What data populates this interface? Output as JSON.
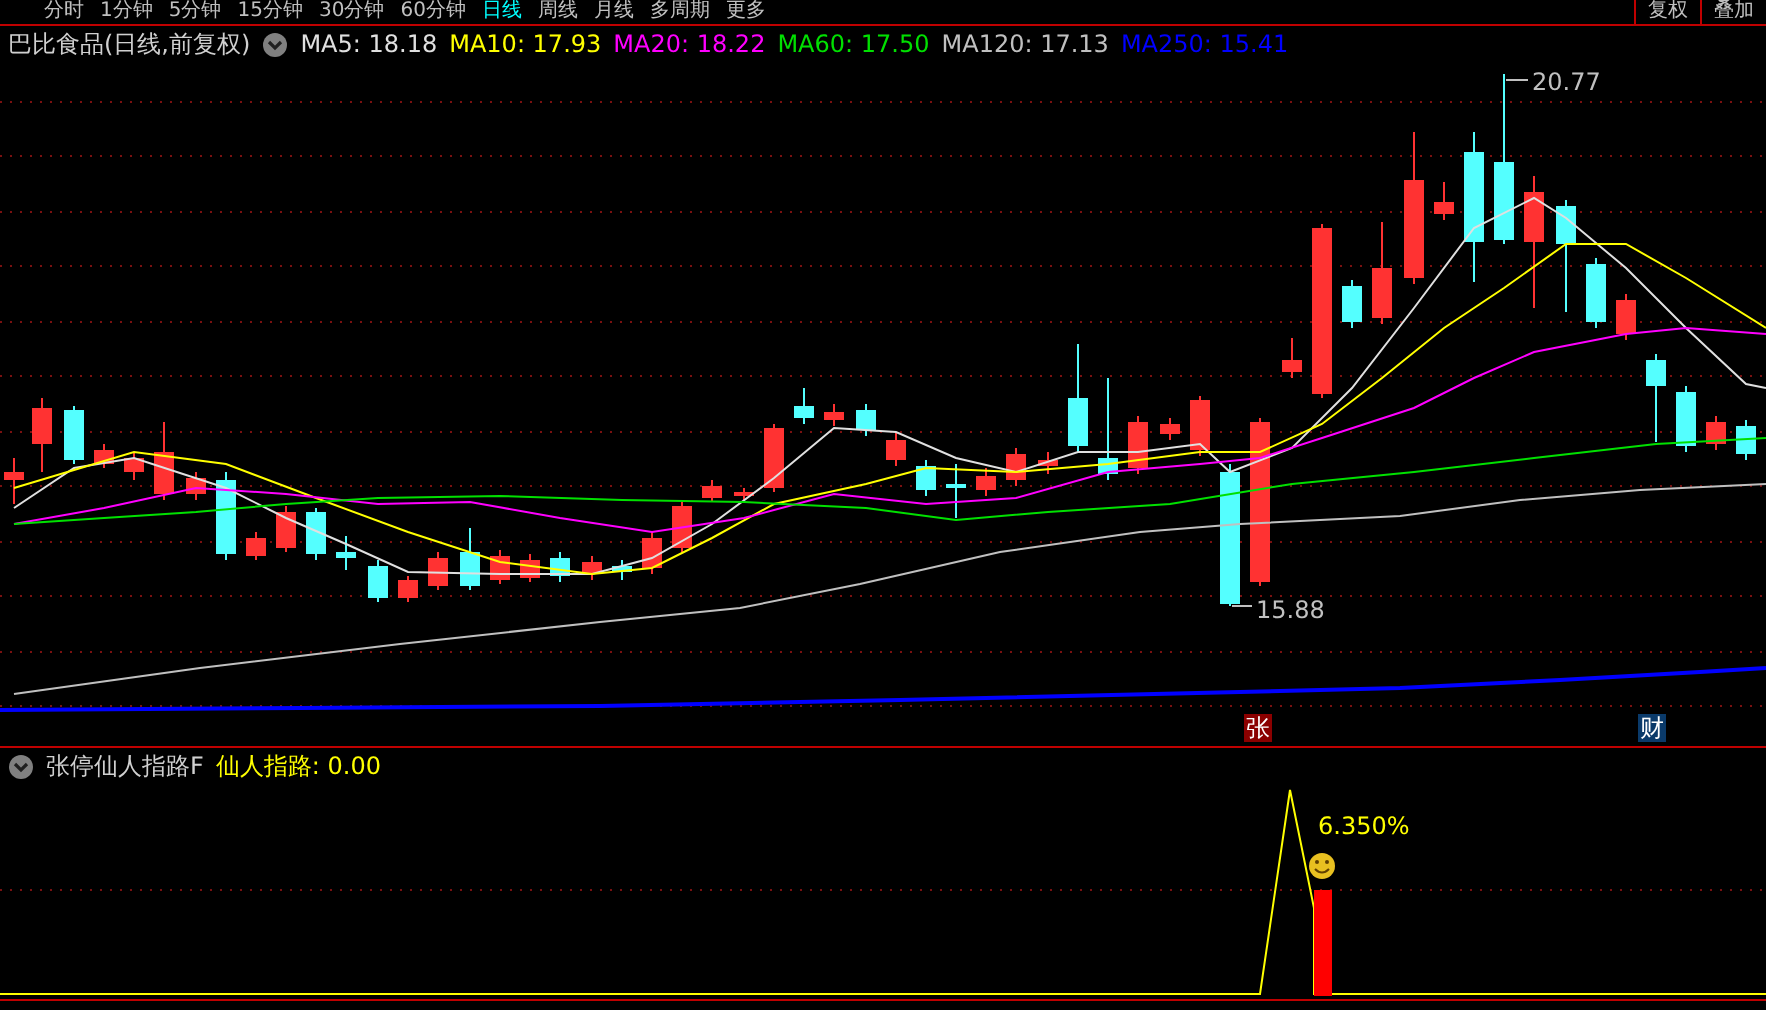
{
  "period_tabs": [
    {
      "label": "分时",
      "selected": false
    },
    {
      "label": "1分钟",
      "selected": false
    },
    {
      "label": "5分钟",
      "selected": false
    },
    {
      "label": "15分钟",
      "selected": false
    },
    {
      "label": "30分钟",
      "selected": false
    },
    {
      "label": "60分钟",
      "selected": false
    },
    {
      "label": "日线",
      "selected": true
    },
    {
      "label": "周线",
      "selected": false
    },
    {
      "label": "月线",
      "selected": false
    },
    {
      "label": "多周期",
      "selected": false
    },
    {
      "label": "更多",
      "selected": false
    }
  ],
  "toolbar_buttons": [
    "复权",
    "叠加"
  ],
  "main_chart": {
    "title": "巴比食品(日线,前复权)",
    "moving_averages": [
      {
        "label": "MA5: 18.18",
        "color": "#e0e0e0"
      },
      {
        "label": "MA10: 17.93",
        "color": "#ffff00"
      },
      {
        "label": "MA20: 18.22",
        "color": "#ff00ff"
      },
      {
        "label": "MA60: 17.50",
        "color": "#00e000"
      },
      {
        "label": "MA120: 17.13",
        "color": "#c0c0c0"
      },
      {
        "label": "MA250: 15.41",
        "color": "#0000ff"
      }
    ],
    "high_label": "20.77",
    "low_label": "15.88",
    "markers": [
      {
        "text": "张",
        "color": "#8b0000"
      },
      {
        "text": "财",
        "color": "#0a3a6a"
      }
    ]
  },
  "indicator": {
    "name": "张停仙人指路F",
    "output": "仙人指路: 0.00",
    "bar_label": "6.350%"
  }
}
